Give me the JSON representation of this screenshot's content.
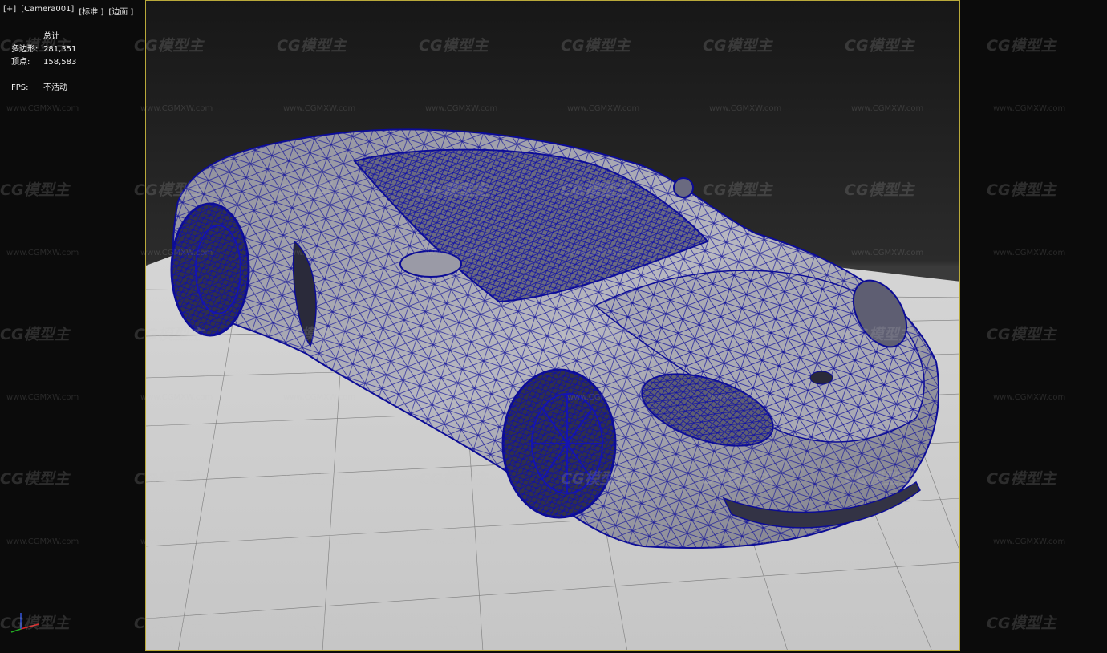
{
  "viewport": {
    "labels": [
      "[+]",
      "[Camera001]",
      "[标准 ]",
      "[边面 ]"
    ],
    "frame_color": "#b9a93a",
    "wire_color": "#0f0fa0"
  },
  "stats": {
    "title": "总计",
    "polys_label": "多边形:",
    "polys_value": "281,351",
    "verts_label": "顶点:",
    "verts_value": "158,583",
    "fps_label": "FPS:",
    "fps_value": "不活动"
  },
  "watermark": {
    "logo": "CG模型主",
    "url": "www.CGMXW.com"
  }
}
